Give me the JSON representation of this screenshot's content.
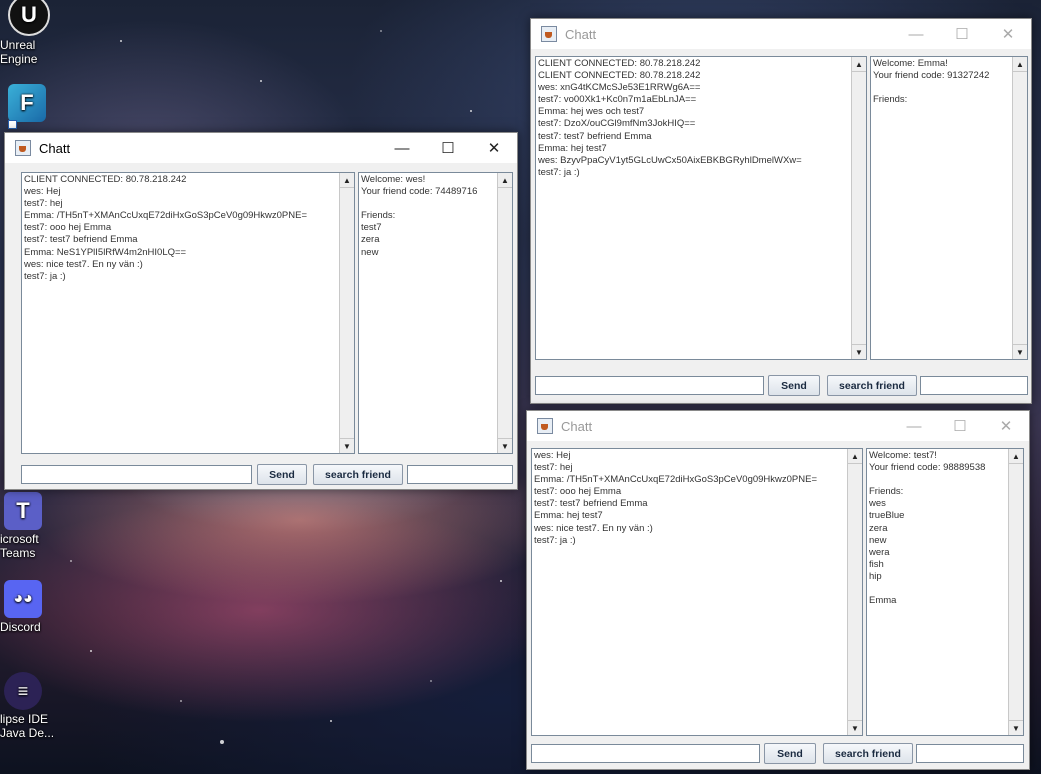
{
  "desktop": {
    "icons": [
      {
        "label_lines": [
          "Unreal",
          "Engine"
        ],
        "icon": "unreal-engine-icon"
      },
      {
        "label_lines": [
          "icrosoft",
          "Teams"
        ],
        "icon": "teams-icon"
      },
      {
        "label_lines": [
          "Discord"
        ],
        "icon": "discord-icon"
      },
      {
        "label_lines": [
          "lipse IDE",
          "Java De..."
        ],
        "icon": "eclipse-icon"
      }
    ]
  },
  "windows": [
    {
      "title": "Chatt",
      "active": true,
      "controls": {
        "minimize": "—",
        "maximize": "☐",
        "close": "✕"
      },
      "chat_log": "CLIENT CONNECTED: 80.78.218.242\nwes: Hej\ntest7: hej\nEmma: /TH5nT+XMAnCcUxqE72diHxGoS3pCeV0g09Hkwz0PNE=\ntest7: ooo hej Emma\ntest7: test7 befriend Emma\nEmma: NeS1YPlI5lRfW4m2nHI0LQ==\nwes: nice test7. En ny vän :)\ntest7: ja :)",
      "info_panel": "Welcome: wes!\nYour friend code: 74489716\n\nFriends:\ntest7\nzera\nnew",
      "message_input": "",
      "send_label": "Send",
      "search_label": "search friend",
      "friend_code_input": ""
    },
    {
      "title": "Chatt",
      "active": false,
      "controls": {
        "minimize": "—",
        "maximize": "☐",
        "close": "✕"
      },
      "chat_log": "CLIENT CONNECTED: 80.78.218.242\nCLIENT CONNECTED: 80.78.218.242\nwes: xnG4tKCMcSJe53E1RRWg6A==\ntest7: vo00Xk1+Kc0n7m1aEbLnJA==\nEmma: hej wes och test7\ntest7: DzoX/ouCGl9mfNm3JokHIQ==\ntest7: test7 befriend Emma\nEmma: hej test7\nwes: BzyvPpaCyV1yt5GLcUwCx50AixEBKBGRyhlDmelWXw=\ntest7: ja :)",
      "info_panel": "Welcome: Emma!\nYour friend code: 91327242\n\nFriends:",
      "message_input": "",
      "send_label": "Send",
      "search_label": "search friend",
      "friend_code_input": ""
    },
    {
      "title": "Chatt",
      "active": false,
      "controls": {
        "minimize": "—",
        "maximize": "☐",
        "close": "✕"
      },
      "chat_log": "wes: Hej\ntest7: hej\nEmma: /TH5nT+XMAnCcUxqE72diHxGoS3pCeV0g09Hkwz0PNE=\ntest7: ooo hej Emma\ntest7: test7 befriend Emma\nEmma: hej test7\nwes: nice test7. En ny vän :)\ntest7: ja :)",
      "info_panel": "Welcome: test7!\nYour friend code: 98889538\n\nFriends:\nwes\ntrueBlue\nzera\nnew\nwera\nfish\nhip\n\nEmma",
      "message_input": "",
      "send_label": "Send",
      "search_label": "search friend",
      "friend_code_input": ""
    }
  ]
}
